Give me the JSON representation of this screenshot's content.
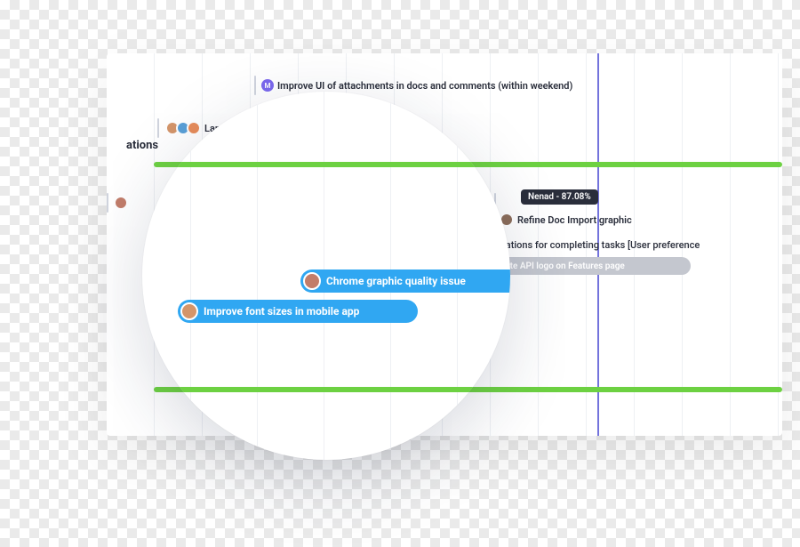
{
  "panel": {
    "task_improve_ui": "Improve UI of attachments in docs and comments (within weekend)",
    "task_landing": "Landi",
    "group_label": "ations",
    "task_refine_doc": "Refine Doc Import graphic",
    "task_celebrations": "ebrations for completing tasks [User preference",
    "task_api_logo": "pdate API logo on Features page"
  },
  "tooltip": {
    "nenad": "Nenad - 87.08%"
  },
  "lens": {
    "task_chrome": "Chrome graphic quality issue",
    "task_font_sizes": "Improve font sizes in mobile app"
  },
  "colors": {
    "accent_blue": "#30a7f2",
    "green": "#6dd142",
    "purple": "#7b68ee",
    "today_line": "#5b5bd6",
    "grey_pill": "#c4c7cf"
  }
}
